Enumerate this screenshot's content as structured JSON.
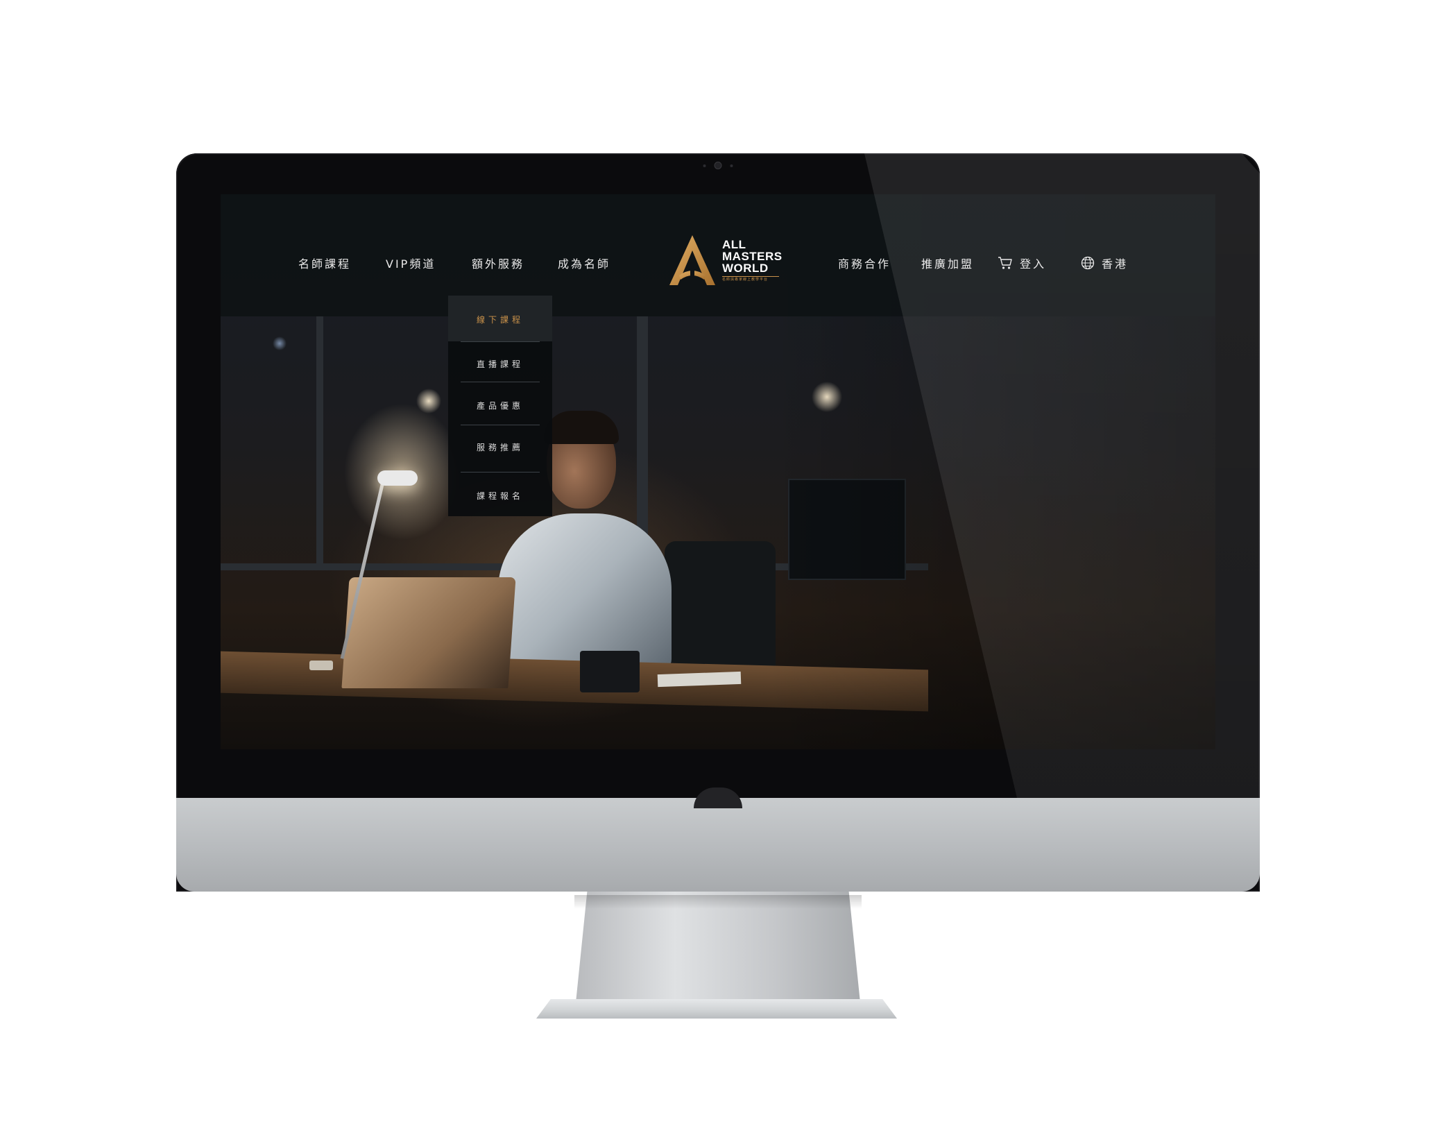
{
  "nav": {
    "left_items": [
      {
        "label": "名師課程"
      },
      {
        "label": "VIP頻道"
      },
      {
        "label": "額外服務"
      },
      {
        "label": "成為名師"
      }
    ],
    "right_items": [
      {
        "label": "商務合作"
      },
      {
        "label": "推廣加盟"
      },
      {
        "label": "登入",
        "icon": "cart-icon"
      },
      {
        "label": "香港",
        "icon": "globe-icon"
      }
    ]
  },
  "logo": {
    "line1": "ALL",
    "line2": "MASTERS",
    "line3": "WORLD",
    "tagline": "名師與專家線上教學平台"
  },
  "dropdown": {
    "items": [
      {
        "label": "線下課程",
        "active": true
      },
      {
        "label": "直播課程",
        "active": false
      },
      {
        "label": "產品優惠",
        "active": false
      },
      {
        "label": "服務推薦",
        "active": false
      },
      {
        "label": "課程報名",
        "active": false
      }
    ]
  },
  "colors": {
    "accent": "#c9914a",
    "nav_text": "#e9e9e9",
    "nav_bg": "#0e1215"
  }
}
